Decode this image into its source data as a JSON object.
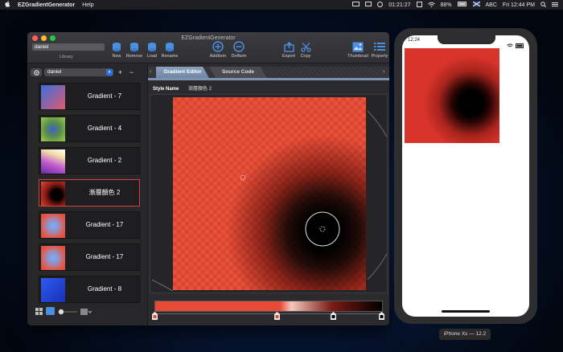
{
  "menubar": {
    "app_name": "EZGradientGenerator",
    "menu_help": "Help",
    "clock": "01:21:27",
    "battery": "88%",
    "input_source": "ABC",
    "datetime": "Fri 12:44 PM"
  },
  "window": {
    "title": "EZGradientGenerator",
    "library_value": "daniel",
    "library_label": "Library",
    "toolbar": {
      "new": "New",
      "remove": "Remove",
      "load": "Load",
      "rename": "Rename",
      "add_item": "AddItem",
      "del_item": "DelItem",
      "export": "Export",
      "copy": "Copy",
      "thumbnail": "Thumbnail",
      "property": "Property"
    }
  },
  "sidebar": {
    "library_select": "daniel",
    "items": [
      {
        "label": "Gradient - 7",
        "selected": false
      },
      {
        "label": "Gradient - 4",
        "selected": false
      },
      {
        "label": "Gradient - 2",
        "selected": false
      },
      {
        "label": "漸層顏色 2",
        "selected": true
      },
      {
        "label": "Gradient - 17",
        "selected": false
      },
      {
        "label": "Gradient - 17",
        "selected": false
      },
      {
        "label": "Gradient - 8",
        "selected": false
      }
    ]
  },
  "editor": {
    "tabs": [
      {
        "label": "Gradient Editor",
        "active": true
      },
      {
        "label": "Source Code",
        "active": false
      }
    ],
    "style_name_label": "Style Name",
    "style_name_value": "漸層顏色 2"
  },
  "simulator": {
    "time": "12:24",
    "device_label": "iPhone Xs — 12.2"
  }
}
